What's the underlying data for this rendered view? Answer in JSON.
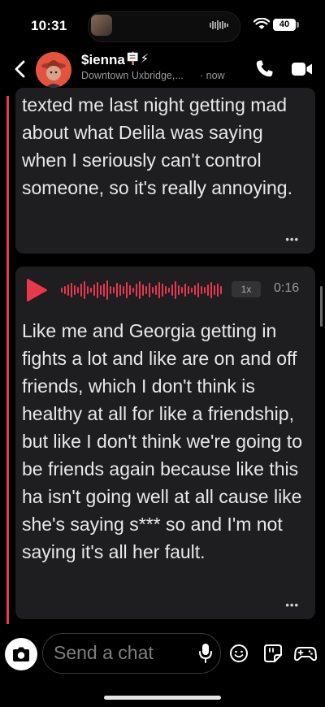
{
  "status_bar": {
    "time": "10:31",
    "battery": "40"
  },
  "header": {
    "contact_name": "$ienna",
    "name_emoji": "🪧⚡",
    "location": "Downtown Uxbridge,...",
    "time": "· now"
  },
  "messages": [
    {
      "type": "text",
      "text": "texted me last night getting mad about what Delila was saying when I seriously can't control someone, so it's really annoying.",
      "more": "•••"
    },
    {
      "type": "voice",
      "speed": "1x",
      "duration": "0:16",
      "text": "Like me and Georgia getting in fights a lot and like are on and off friends, which I don't think is healthy at all for like a friendship, but like I don't think we're going to be friends again because like this ha isn't going well at all cause like she's saying s*** so and I'm not saying it's all her fault.",
      "more": "•••"
    }
  ],
  "composer": {
    "placeholder": "Send a chat"
  },
  "colors": {
    "accent": "#e9384b",
    "card": "#1e1e20",
    "background": "#000000"
  }
}
